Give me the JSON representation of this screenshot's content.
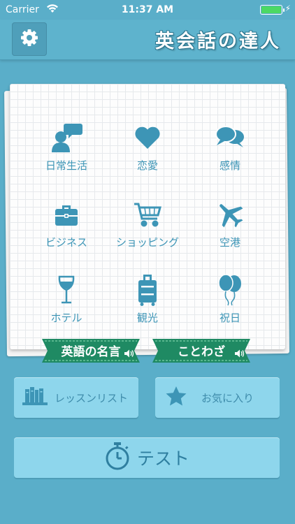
{
  "status_bar": {
    "carrier": "Carrier",
    "time": "11:37 AM",
    "battery_level": 1.0
  },
  "header": {
    "title": "英会話の達人",
    "settings_icon": "gear-icon"
  },
  "categories": [
    {
      "label": "日常生活",
      "icon": "person-speech-icon"
    },
    {
      "label": "恋愛",
      "icon": "heart-icon"
    },
    {
      "label": "感情",
      "icon": "chat-bubbles-icon"
    },
    {
      "label": "ビジネス",
      "icon": "briefcase-icon"
    },
    {
      "label": "ショッピング",
      "icon": "shopping-cart-icon"
    },
    {
      "label": "空港",
      "icon": "airplane-icon"
    },
    {
      "label": "ホテル",
      "icon": "wine-glass-icon"
    },
    {
      "label": "観光",
      "icon": "suitcase-icon"
    },
    {
      "label": "祝日",
      "icon": "balloons-icon"
    }
  ],
  "ribbons": [
    {
      "label": "英語の名言",
      "icon": "speaker-icon"
    },
    {
      "label": "ことわざ",
      "icon": "speaker-icon"
    }
  ],
  "buttons": {
    "lesson_list": {
      "label": "レッスンリスト",
      "icon": "books-icon"
    },
    "favorites": {
      "label": "お気に入り",
      "icon": "star-icon"
    },
    "test": {
      "label": "テスト",
      "icon": "stopwatch-icon"
    }
  },
  "colors": {
    "background": "#5aaec9",
    "icon_blue": "#3d95b6",
    "ribbon_green": "#1f8a63",
    "button_fill": "#8ed6ec"
  }
}
